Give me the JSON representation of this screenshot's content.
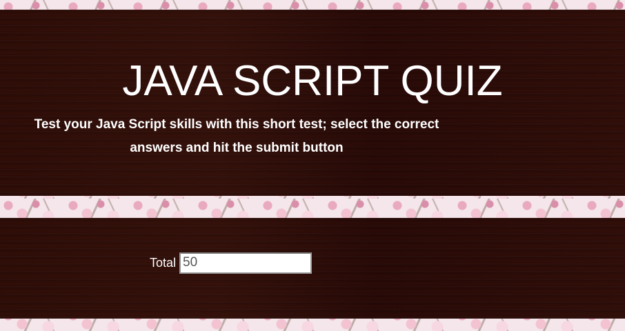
{
  "header": {
    "title": "JAVA SCRIPT QUIZ",
    "subtitle": "Test your Java Script skills with this short test; select the correct answers and hit the submit button"
  },
  "total": {
    "label": "Total",
    "value": "50"
  },
  "colors": {
    "panel": "#2a0b06",
    "text": "#ffffff",
    "floral": "#f4e6ea"
  }
}
